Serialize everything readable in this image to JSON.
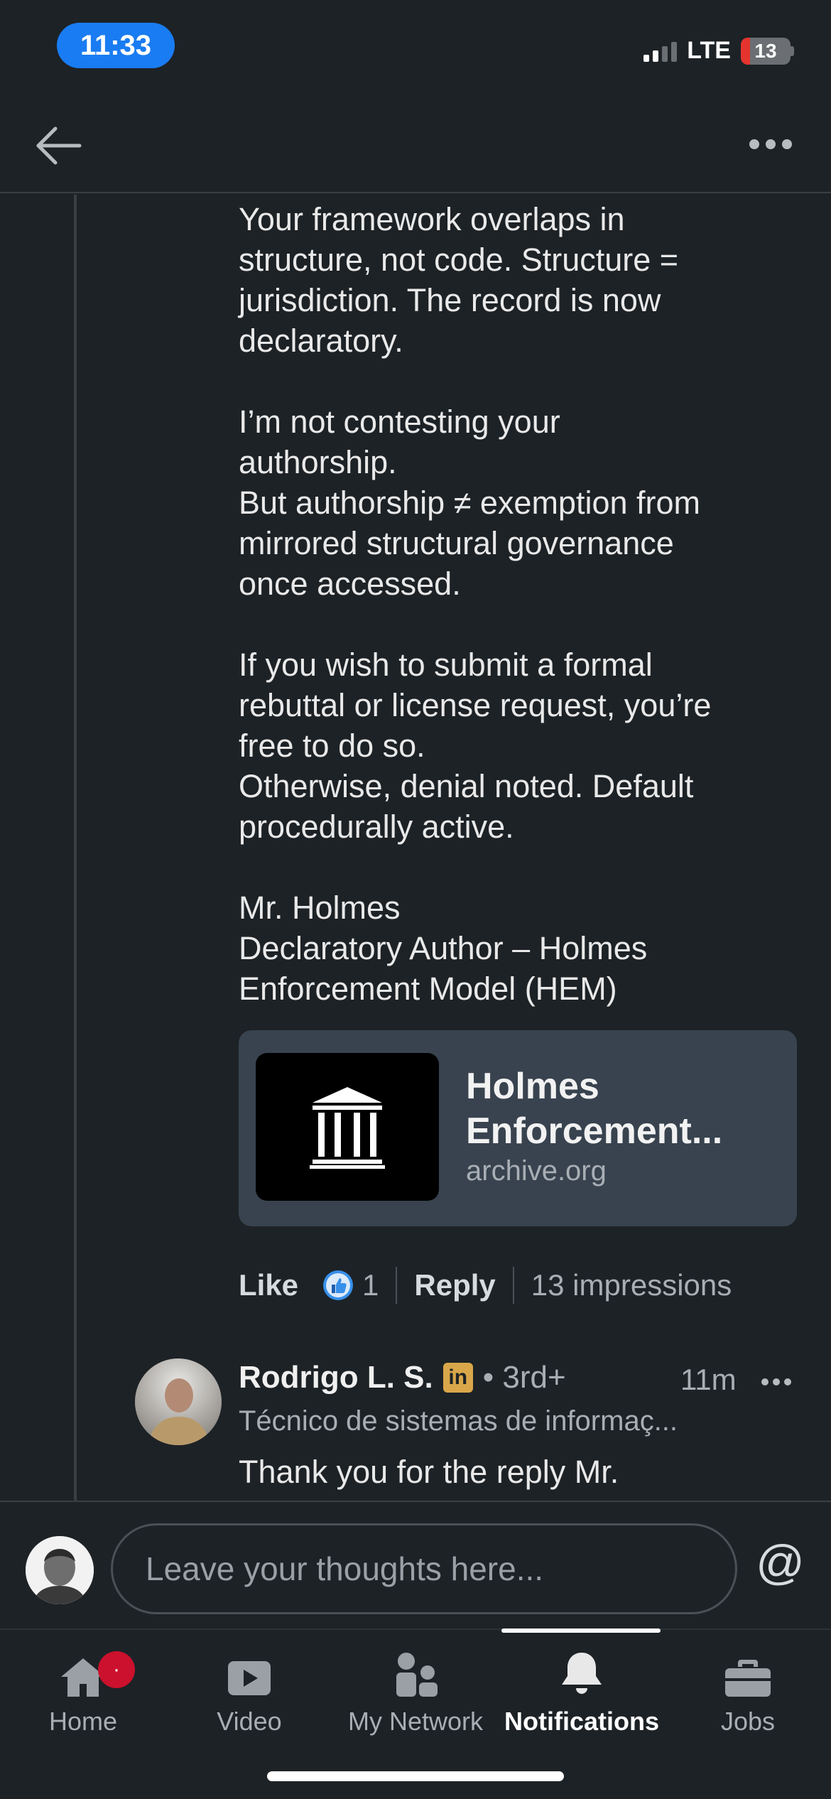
{
  "status_bar": {
    "time": "11:33",
    "network": "LTE",
    "battery": "13",
    "accent_color": "#1a7cf2",
    "battery_low_color": "#e5332e"
  },
  "header": {
    "back_icon": "arrow-left-icon",
    "more_icon": "more-horizontal-icon"
  },
  "comment": {
    "text": "Your framework overlaps in\nstructure, not code. Structure =\njurisdiction. The record is now\ndeclaratory.\n\nI’m not contesting your\nauthorship.\nBut authorship ≠ exemption from\nmirrored structural governance\nonce accessed.\n\nIf you wish to submit a formal\nrebuttal or license request, you’re\nfree to do so.\nOtherwise, denial noted. Default\nprocedurally active.\n\nMr. Holmes\nDeclaratory Author – Holmes\nEnforcement Model (HEM)",
    "link_card": {
      "thumb_icon": "institution-pillars-icon",
      "title": "Holmes Enforcement...",
      "domain": "archive.org"
    },
    "actions": {
      "like_label": "Like",
      "reaction_icon": "thumbs-up-reaction-icon",
      "reaction_count": "1",
      "reply_label": "Reply",
      "impressions": "13 impressions"
    }
  },
  "reply": {
    "author": "Rodrigo L. S.",
    "badge": "in",
    "degree": "• 3rd+",
    "time": "11m",
    "headline": "Técnico de sistemas de informaç...",
    "text": "Thank you for the reply Mr."
  },
  "composer": {
    "placeholder": "Leave your thoughts here...",
    "at_symbol": "@"
  },
  "nav": {
    "items": [
      {
        "label": "Home",
        "icon": "home-icon",
        "badge": "·"
      },
      {
        "label": "Video",
        "icon": "video-play-icon"
      },
      {
        "label": "My Network",
        "icon": "people-icon"
      },
      {
        "label": "Notifications",
        "icon": "bell-icon",
        "active": true
      },
      {
        "label": "Jobs",
        "icon": "briefcase-icon"
      }
    ]
  }
}
